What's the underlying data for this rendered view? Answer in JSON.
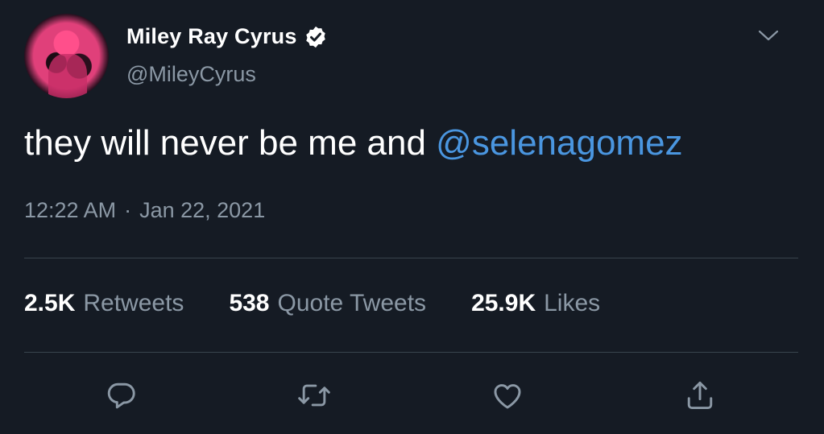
{
  "author": {
    "display_name": "Miley Ray Cyrus",
    "handle": "@MileyCyrus"
  },
  "tweet": {
    "text_before_mention": "they will never be me and ",
    "mention": "@selenagomez"
  },
  "meta": {
    "time": "12:22 AM",
    "separator": "·",
    "date": "Jan 22, 2021"
  },
  "stats": [
    {
      "count": "2.5K",
      "label": "Retweets"
    },
    {
      "count": "538",
      "label": "Quote Tweets"
    },
    {
      "count": "25.9K",
      "label": "Likes"
    }
  ],
  "colors": {
    "background": "#151b24",
    "mention": "#4a96e0",
    "secondary_text": "#8b98a5",
    "avatar_tint": "#e0407a"
  },
  "icons": [
    "verified-badge-icon",
    "chevron-down-icon",
    "reply-icon",
    "retweet-icon",
    "like-icon",
    "share-icon"
  ]
}
